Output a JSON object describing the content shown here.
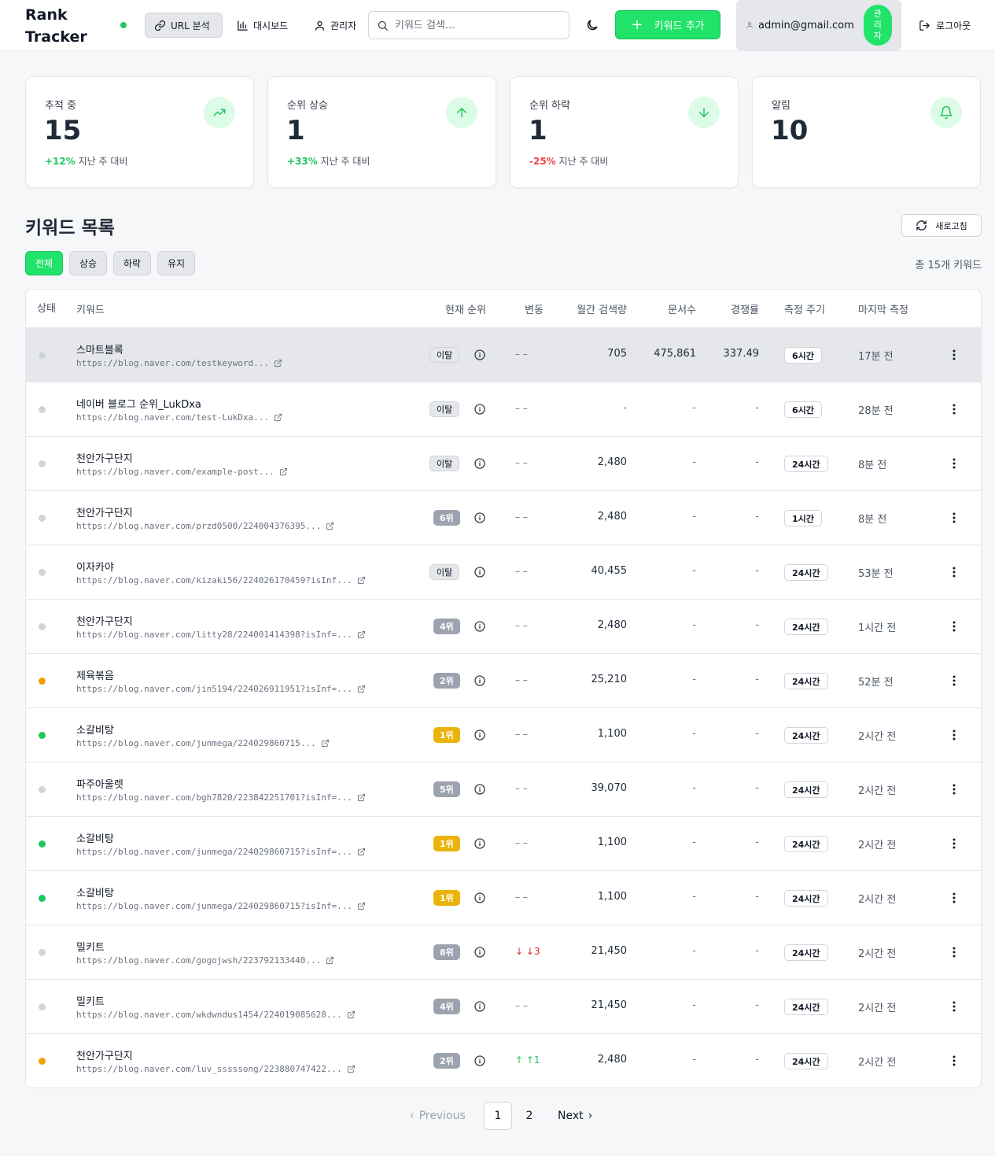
{
  "app": {
    "brand": "Rank Tracker",
    "nav": [
      {
        "label": "URL 분석",
        "icon": "link-icon",
        "active": true
      },
      {
        "label": "대시보드",
        "icon": "bar-chart-icon",
        "active": false
      },
      {
        "label": "관리자",
        "icon": "user-icon",
        "active": false
      }
    ],
    "search_placeholder": "키워드 검색...",
    "add_label": "키워드 추가",
    "user_email": "admin@gmail.com",
    "role": "관리자",
    "logout_label": "로그아웃",
    "accent": "#22e36a"
  },
  "stats": [
    {
      "label": "추적 중",
      "value": "15",
      "pct": "+12%",
      "suffix": "지난 주 대비",
      "icon": "trending-up-icon"
    },
    {
      "label": "순위 상승",
      "value": "1",
      "pct": "+33%",
      "suffix": "지난 주 대비",
      "icon": "arrow-up-icon"
    },
    {
      "label": "순위 하락",
      "value": "1",
      "pct": "-25%",
      "suffix": "지난 주 대비",
      "icon": "arrow-down-icon"
    },
    {
      "label": "알림",
      "value": "10",
      "pct": "",
      "suffix": "",
      "icon": "bell-icon"
    }
  ],
  "list": {
    "title": "키워드 목록",
    "refresh_label": "새로고침",
    "tabs": [
      "전체",
      "상승",
      "하락",
      "유지"
    ],
    "total": "총 15개 키워드",
    "columns": {
      "status": "상태",
      "keyword": "키워드",
      "rank": "현재 순위",
      "change": "변동",
      "volume": "월간 검색량",
      "docs": "문서수",
      "competition": "경쟁률",
      "period": "측정 주기",
      "last": "마지막 측정"
    },
    "rows": [
      {
        "status": "gray",
        "keyword": "스마트블록",
        "url": "https://blog.naver.com/testkeyword...",
        "rank": "이탈",
        "rank_style": "out",
        "change": "– –",
        "change_dir": "none",
        "volume": "705",
        "docs": "475,861",
        "competition": "337.49",
        "period": "6시간",
        "last": "17분 전"
      },
      {
        "status": "gray",
        "keyword": "네이버 블로그 순위_LukDxa",
        "url": "https://blog.naver.com/test-LukDxa...",
        "rank": "이탈",
        "rank_style": "out",
        "change": "– –",
        "change_dir": "none",
        "volume": "-",
        "docs": "-",
        "competition": "-",
        "period": "6시간",
        "last": "28분 전"
      },
      {
        "status": "gray",
        "keyword": "천안가구단지",
        "url": "https://blog.naver.com/example-post...",
        "rank": "이탈",
        "rank_style": "out",
        "change": "– –",
        "change_dir": "none",
        "volume": "2,480",
        "docs": "-",
        "competition": "-",
        "period": "24시간",
        "last": "8분 전"
      },
      {
        "status": "gray",
        "keyword": "천안가구단지",
        "url": "https://blog.naver.com/przd0500/224004376395...",
        "rank": "6위",
        "rank_style": "gray",
        "change": "– –",
        "change_dir": "none",
        "volume": "2,480",
        "docs": "-",
        "competition": "-",
        "period": "1시간",
        "last": "8분 전"
      },
      {
        "status": "gray",
        "keyword": "이자카야",
        "url": "https://blog.naver.com/kizaki56/224026170459?isInf...",
        "rank": "이탈",
        "rank_style": "out",
        "change": "– –",
        "change_dir": "none",
        "volume": "40,455",
        "docs": "-",
        "competition": "-",
        "period": "24시간",
        "last": "53분 전"
      },
      {
        "status": "gray",
        "keyword": "천안가구단지",
        "url": "https://blog.naver.com/litty28/224001414398?isInf=...",
        "rank": "4위",
        "rank_style": "gray",
        "change": "– –",
        "change_dir": "none",
        "volume": "2,480",
        "docs": "-",
        "competition": "-",
        "period": "24시간",
        "last": "1시간 전"
      },
      {
        "status": "orange",
        "keyword": "제육볶음",
        "url": "https://blog.naver.com/jin5194/224026911951?isInf=...",
        "rank": "2위",
        "rank_style": "gray",
        "change": "– –",
        "change_dir": "none",
        "volume": "25,210",
        "docs": "-",
        "competition": "-",
        "period": "24시간",
        "last": "52분 전"
      },
      {
        "status": "green",
        "keyword": "소갈비탕",
        "url": "https://blog.naver.com/junmega/224029860715...",
        "rank": "1위",
        "rank_style": "top",
        "change": "– –",
        "change_dir": "none",
        "volume": "1,100",
        "docs": "-",
        "competition": "-",
        "period": "24시간",
        "last": "2시간 전"
      },
      {
        "status": "gray",
        "keyword": "파주아울렛",
        "url": "https://blog.naver.com/bgh7820/223842251701?isInf=...",
        "rank": "5위",
        "rank_style": "gray",
        "change": "– –",
        "change_dir": "none",
        "volume": "39,070",
        "docs": "-",
        "competition": "-",
        "period": "24시간",
        "last": "2시간 전"
      },
      {
        "status": "green",
        "keyword": "소갈비탕",
        "url": "https://blog.naver.com/junmega/224029860715?isInf=...",
        "rank": "1위",
        "rank_style": "top",
        "change": "– –",
        "change_dir": "none",
        "volume": "1,100",
        "docs": "-",
        "competition": "-",
        "period": "24시간",
        "last": "2시간 전"
      },
      {
        "status": "green",
        "keyword": "소갈비탕",
        "url": "https://blog.naver.com/junmega/224029860715?isInf=...",
        "rank": "1위",
        "rank_style": "top",
        "change": "– –",
        "change_dir": "none",
        "volume": "1,100",
        "docs": "-",
        "competition": "-",
        "period": "24시간",
        "last": "2시간 전"
      },
      {
        "status": "gray",
        "keyword": "밀키트",
        "url": "https://blog.naver.com/gogojwsh/223792133440...",
        "rank": "8위",
        "rank_style": "gray",
        "change": "↓ ↓3",
        "change_dir": "down",
        "volume": "21,450",
        "docs": "-",
        "competition": "-",
        "period": "24시간",
        "last": "2시간 전"
      },
      {
        "status": "gray",
        "keyword": "밀키트",
        "url": "https://blog.naver.com/wkdwndus1454/224019085628...",
        "rank": "4위",
        "rank_style": "gray",
        "change": "– –",
        "change_dir": "none",
        "volume": "21,450",
        "docs": "-",
        "competition": "-",
        "period": "24시간",
        "last": "2시간 전"
      },
      {
        "status": "orange",
        "keyword": "천안가구단지",
        "url": "https://blog.naver.com/luv_sssssong/223880747422...",
        "rank": "2위",
        "rank_style": "gray",
        "change": "↑ ↑1",
        "change_dir": "up",
        "volume": "2,480",
        "docs": "-",
        "competition": "-",
        "period": "24시간",
        "last": "2시간 전"
      }
    ]
  },
  "pagination": {
    "previous": "Previous",
    "next": "Next",
    "pages": [
      "1",
      "2"
    ],
    "current": "1"
  },
  "colors": {
    "status_green": "#22c55e",
    "status_orange": "#f59e0b",
    "status_gray": "#d1d5db",
    "rank_top": "#eab308",
    "rank_gray": "#9ca3af"
  }
}
